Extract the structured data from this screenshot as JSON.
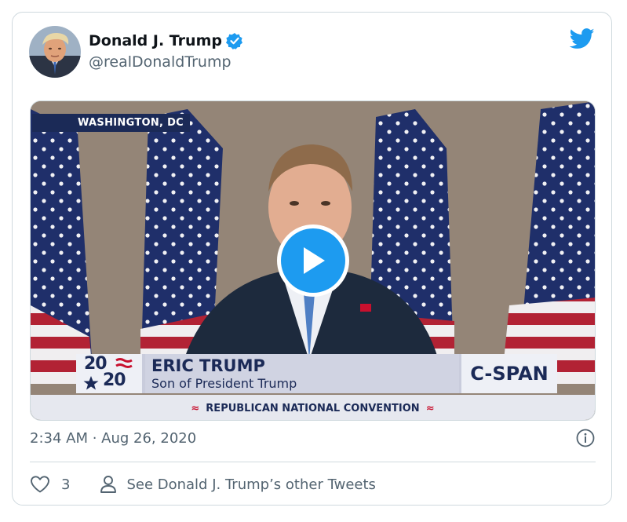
{
  "tweet": {
    "display_name": "Donald J. Trump",
    "handle": "@realDonaldTrump",
    "timestamp": "2:34 AM · Aug 26, 2020",
    "like_count": "3",
    "other_tweets_label": "See Donald J. Trump’s other Tweets"
  },
  "icons": {
    "brand": "twitter-bird-icon",
    "verified": "verified-badge-icon",
    "play": "play-icon",
    "info": "info-icon",
    "like": "heart-icon",
    "profile": "person-icon"
  },
  "video": {
    "location": "WASHINGTON, DC",
    "logo_top": "20",
    "logo_bottom": "20",
    "speaker_name": "ERIC TRUMP",
    "speaker_title": "Son of President Trump",
    "network": "C-SPAN",
    "event": "REPUBLICAN NATIONAL CONVENTION"
  },
  "colors": {
    "accent": "#1d9bf0",
    "text_primary": "#0f1419",
    "text_secondary": "#536471",
    "border": "#cfd9de",
    "broadcast_navy": "#1b2a57",
    "broadcast_red": "#c8102e"
  }
}
